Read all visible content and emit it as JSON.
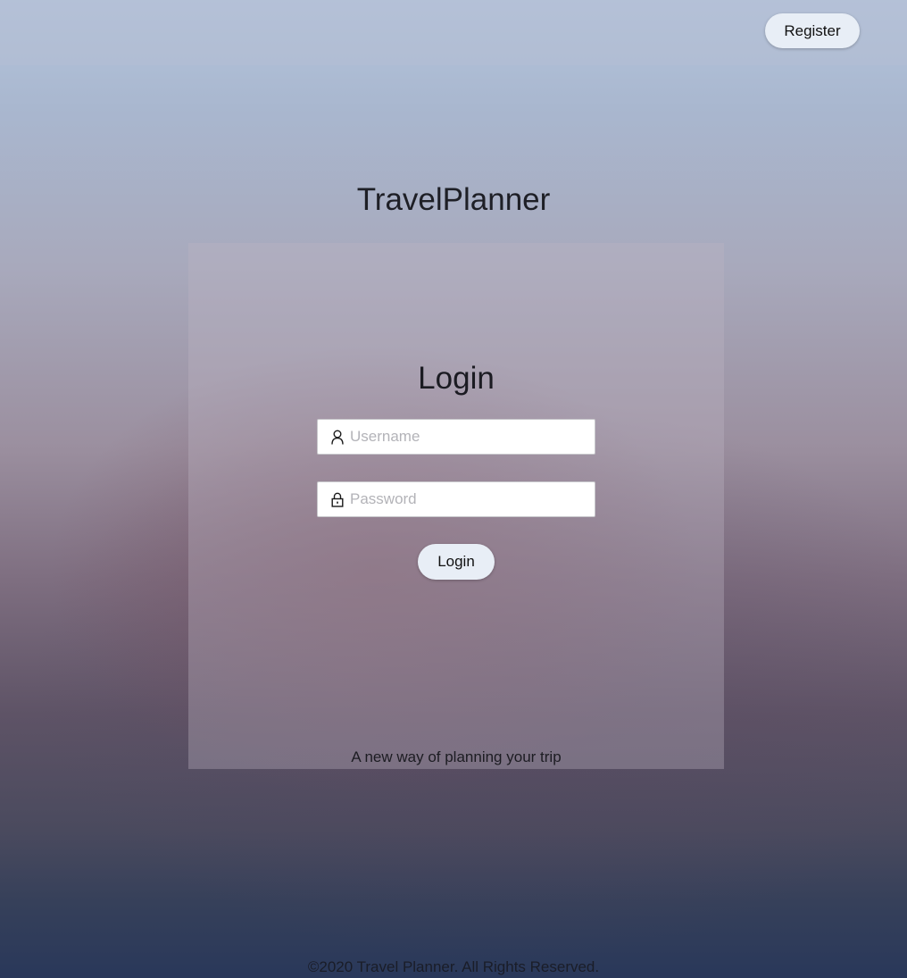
{
  "header": {
    "register_label": "Register"
  },
  "brand": {
    "title": "TravelPlanner"
  },
  "login_card": {
    "title": "Login",
    "username": {
      "placeholder": "Username",
      "value": "",
      "icon": "user-icon"
    },
    "password": {
      "placeholder": "Password",
      "value": "",
      "icon": "lock-icon"
    },
    "submit_label": "Login",
    "tagline": "A new way of planning your trip"
  },
  "footer": {
    "text": "©2020 Travel Planner. All Rights Reserved."
  },
  "colors": {
    "button_bg": "#e8eef6",
    "input_bg": "#ffffff",
    "placeholder": "#b3b3b8"
  }
}
